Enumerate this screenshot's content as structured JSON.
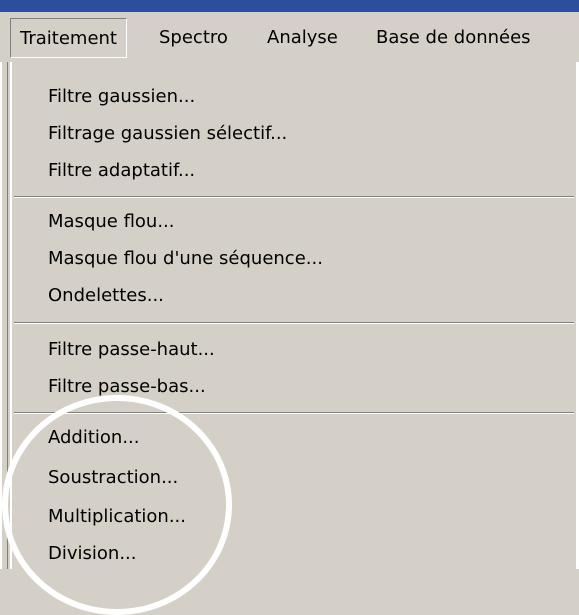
{
  "menubar": {
    "items": [
      {
        "label": "Traitement"
      },
      {
        "label": "Spectro"
      },
      {
        "label": "Analyse"
      },
      {
        "label": "Base de données"
      }
    ]
  },
  "menu": {
    "group1": [
      "Filtre gaussien...",
      "Filtrage gaussien sélectif...",
      "Filtre adaptatif..."
    ],
    "group2": [
      "Masque flou...",
      "Masque flou d'une séquence...",
      "Ondelettes..."
    ],
    "group3": [
      "Filtre passe-haut...",
      "Filtre passe-bas..."
    ],
    "group4": [
      "Addition...",
      "Soustraction...",
      "Multiplication...",
      "Division..."
    ]
  }
}
